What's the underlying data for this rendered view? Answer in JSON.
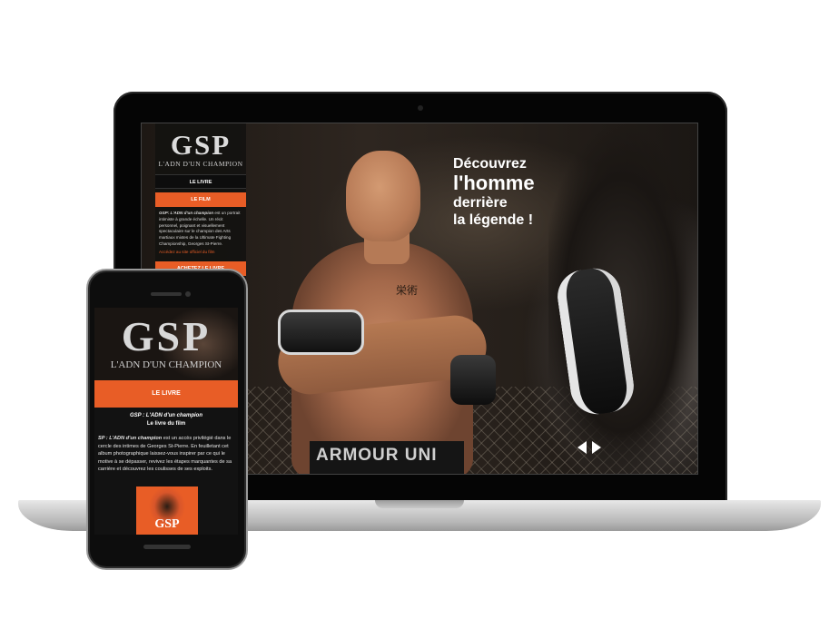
{
  "laptop": {
    "sidebar": {
      "logo": "GSP",
      "logo_sub": "L'ADN D'UN CHAMPION",
      "nav": [
        {
          "label": "LE LIVRE"
        },
        {
          "label": "LE FILM"
        }
      ],
      "desc_title": "GSP: L'ADN d'un champion",
      "desc_body": " est un portrait intimiste à grande échelle. Un récit personnel, poignant et visuellement spectaculaire sur le champion des Arts martiaux mixtes de la Ultimate Fighting Championship, Georges St-Pierre.",
      "link": "Accédez au site officiel du film",
      "buy_button": "ACHETEZ LE LIVRE"
    },
    "headline": {
      "line1": "Découvrez",
      "line2": "l'homme",
      "line3": "derrière",
      "line4": "la légende !"
    },
    "photo_text": {
      "shorts": "ARMOUR UNI",
      "tattoo": "栄術"
    }
  },
  "phone": {
    "logo": "GSP",
    "logo_sub": "L'ADN D'UN CHAMPION",
    "nav_label": "LE LIVRE",
    "title": "GSP : L'ADN d'un champion",
    "subtitle": "Le livre du film",
    "desc_bold": "SP : L'ADN d'un champion",
    "desc_body": " est un accès privilégié dans le cercle des intimes de Georges St-Pierre. En feuilletant cet album photographique laissez-vous inspirer par ce qui le motive à se dépasser, revivez les étapes marquantes de sa carrière et découvrez les coulisses de ses exploits.",
    "thumb_text": "GSP"
  },
  "colors": {
    "accent": "#e85d26",
    "device_black": "#050505",
    "aluminum": "#c8c8c8"
  },
  "icons": {
    "prev": "left-triangle-arrow",
    "next": "right-triangle-arrow"
  }
}
